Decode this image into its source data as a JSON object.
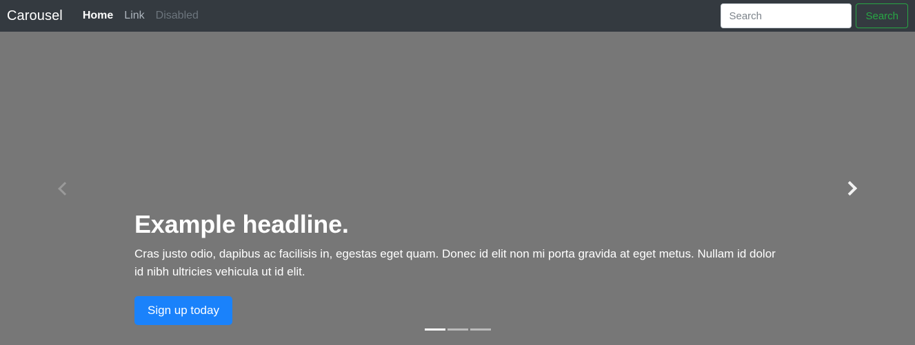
{
  "navbar": {
    "brand": "Carousel",
    "links": [
      {
        "label": "Home",
        "state": "active"
      },
      {
        "label": "Link",
        "state": "normal"
      },
      {
        "label": "Disabled",
        "state": "disabled"
      }
    ],
    "search": {
      "value": "",
      "placeholder": "Search",
      "button_label": "Search",
      "button_border_color": "#28a745",
      "button_text_color": "#28a745"
    },
    "background_color": "#343a40"
  },
  "carousel": {
    "background_color": "#777777",
    "slide": {
      "headline": "Example headline.",
      "body": "Cras justo odio, dapibus ac facilisis in, egestas eget quam. Donec id elit non mi porta gravida at eget metus. Nullam id dolor id nibh ultricies vehicula ut id elit.",
      "cta_label": "Sign up today",
      "cta_color": "#1a82fb"
    },
    "controls": {
      "prev_icon": "chevron-left-icon",
      "next_icon": "chevron-right-icon"
    },
    "indicators": [
      {
        "active": true
      },
      {
        "active": false
      },
      {
        "active": false
      }
    ]
  }
}
